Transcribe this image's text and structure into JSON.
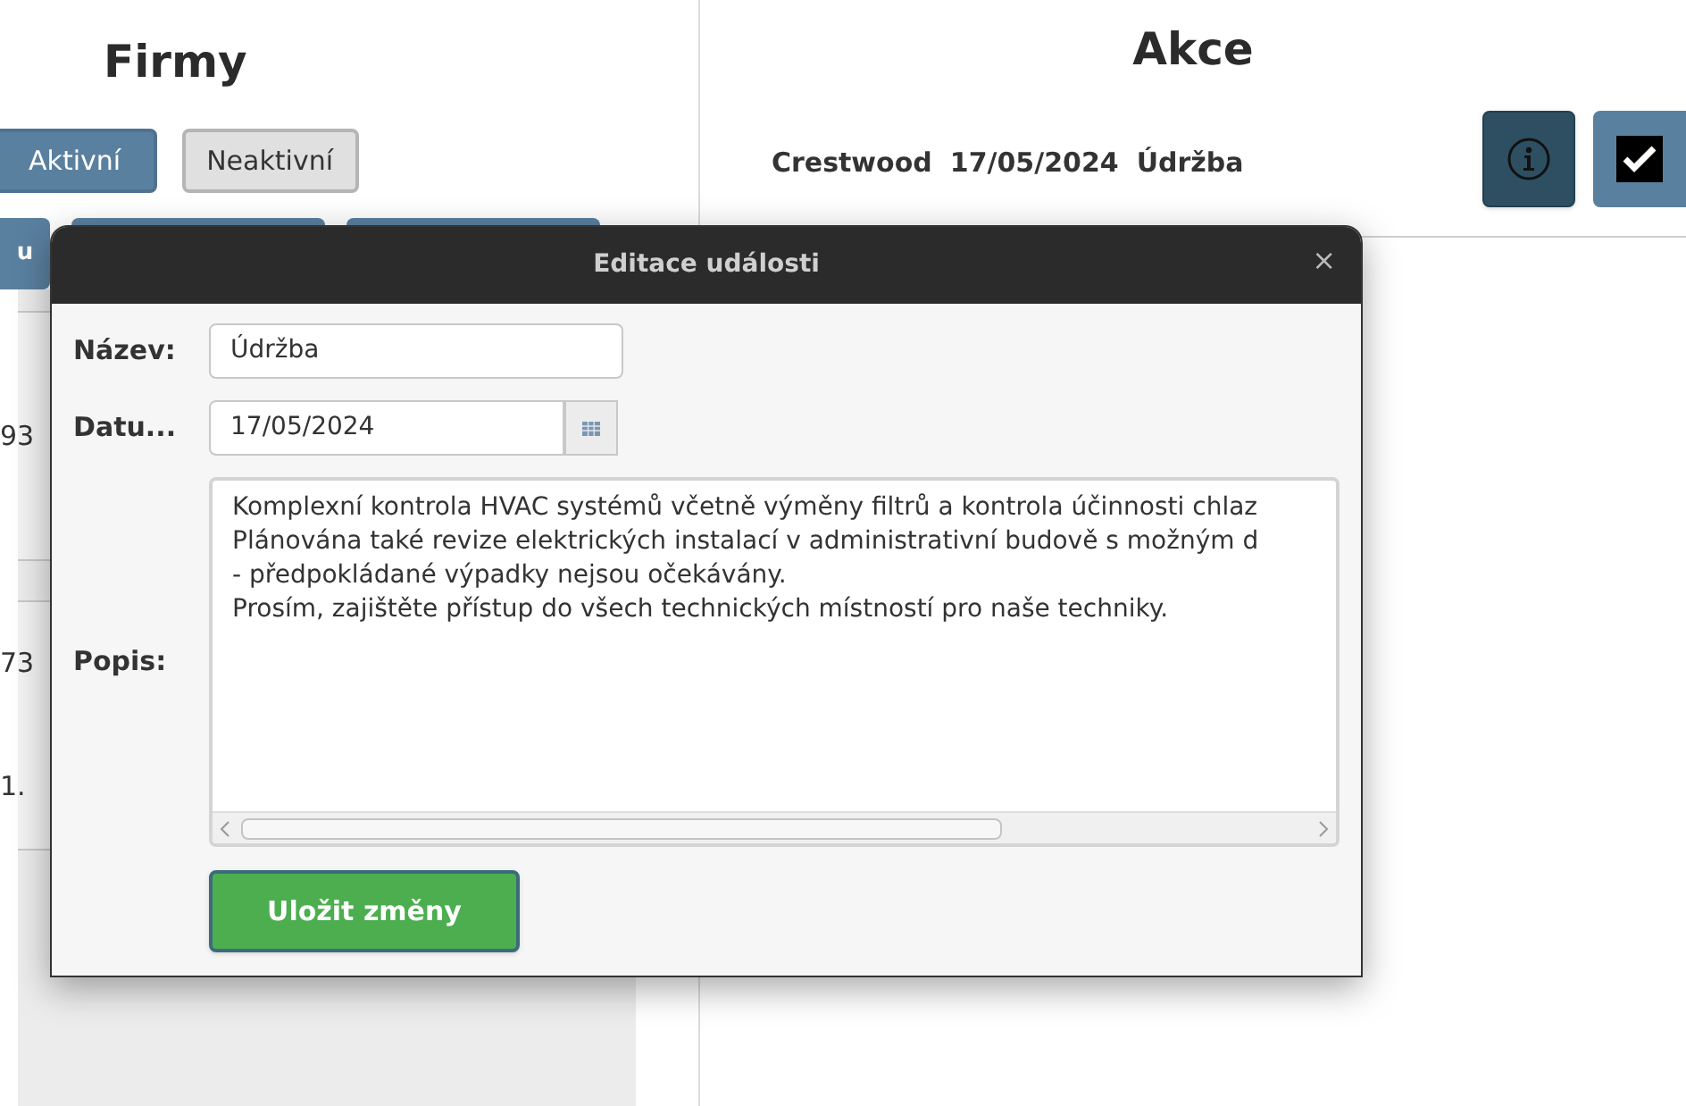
{
  "companies_panel": {
    "title": "Firmy",
    "filters": [
      {
        "label": "Aktivní",
        "selected": true
      },
      {
        "label": "Neaktivní",
        "selected": false
      }
    ],
    "action_button": "u",
    "rows": [
      {
        "lines": [
          "93"
        ]
      },
      {
        "lines": [
          "73",
          "1."
        ]
      }
    ]
  },
  "events_panel": {
    "title": "Akce",
    "event": {
      "company": "Crestwood",
      "date": "17/05/2024",
      "name": "Údržba"
    }
  },
  "dialog": {
    "title": "Editace události",
    "close": "×",
    "name_label": "Název:",
    "name_value": "Údržba",
    "date_label": "Datu...",
    "date_value": "17/05/2024",
    "description_label": "Popis:",
    "description_lines": [
      "Komplexní kontrola HVAC systémů včetně výměny filtrů a kontrola účinnosti chlaz",
      "Plánována také revize elektrických instalací v administrativní budově s možným d",
      "- předpokládané výpadky nejsou očekávány.",
      "Prosím, zajištěte přístup do všech technických místností pro naše techniky."
    ],
    "save_button": "Uložit změny"
  }
}
